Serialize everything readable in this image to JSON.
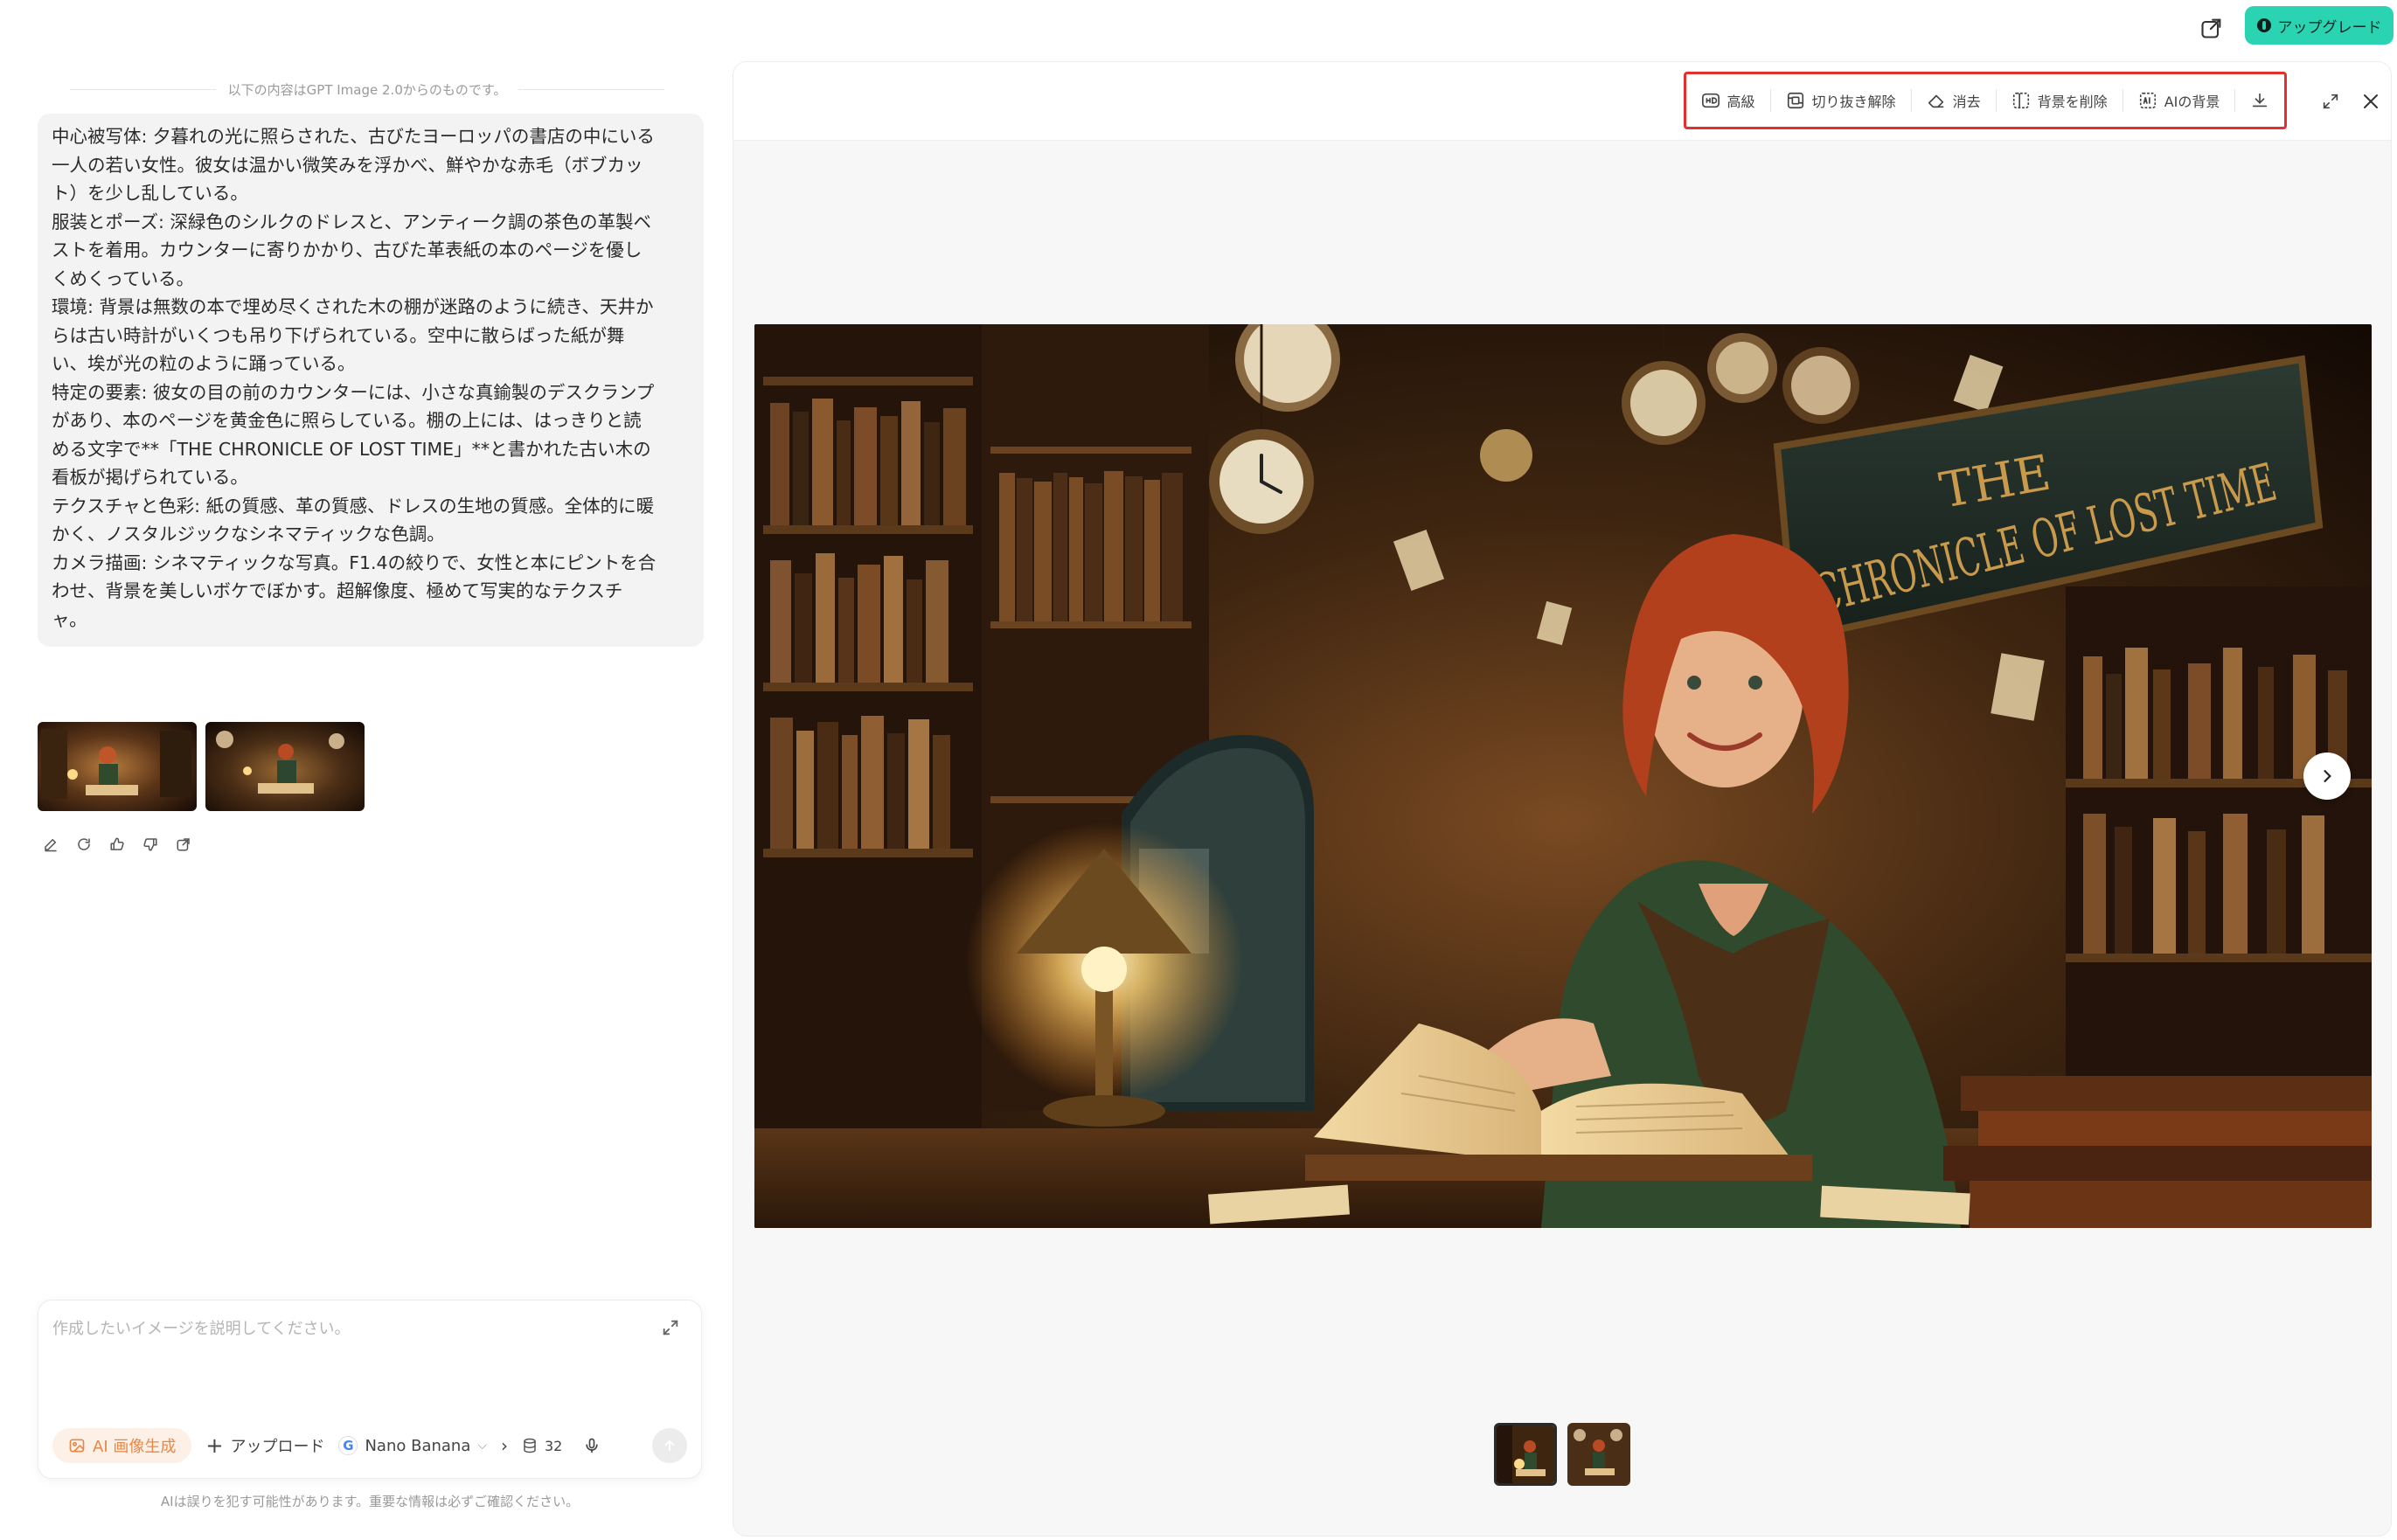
{
  "header": {
    "upgrade_label": "アップグレード",
    "accent_color": "#2ad4b2"
  },
  "chat": {
    "source_note": "以下の内容はGPT Image 2.0からのものです。",
    "prompt_lines": [
      "中心被写体: 夕暮れの光に照らされた、古びたヨーロッパの書店の中にいる",
      "一人の若い女性。彼女は温かい微笑みを浮かべ、鮮やかな赤毛（ボブカッ",
      "ト）を少し乱している。",
      "服装とポーズ: 深緑色のシルクのドレスと、アンティーク調の茶色の革製ベ",
      "ストを着用。カウンターに寄りかかり、古びた革表紙の本のページを優し",
      "くめくっている。",
      "環境: 背景は無数の本で埋め尽くされた木の棚が迷路のように続き、天井か",
      "らは古い時計がいくつも吊り下げられている。空中に散らばった紙が舞",
      "い、埃が光の粒のように踊っている。",
      "特定の要素: 彼女の目の前のカウンターには、小さな真鍮製のデスクランプ",
      "があり、本のページを黄金色に照らしている。棚の上には、はっきりと読",
      "める文字で**「THE CHRONICLE OF LOST TIME」**と書かれた古い木の",
      "看板が掲げられている。",
      "テクスチャと色彩: 紙の質感、革の質感、ドレスの生地の質感。全体的に暖",
      "かく、ノスタルジックなシネマティックな色調。",
      "カメラ描画: シネマティックな写真。F1.4の絞りで、女性と本にピントを合",
      "わせ、背景を美しいボケでぼかす。超解像度、極めて写実的なテクスチ",
      "ャ。"
    ],
    "action_icons": [
      "edit-icon",
      "regenerate-icon",
      "thumbs-up-icon",
      "thumbs-down-icon",
      "share-icon"
    ]
  },
  "composer": {
    "placeholder": "作成したいイメージを説明してください。",
    "ai_gen_label": "AI 画像生成",
    "upload_label": "アップロード",
    "model_label": "Nano Banana",
    "credits": "32",
    "disclaimer": "AIは誤りを犯す可能性があります。重要な情報は必ずご確認ください。",
    "ai_gen_color": "#e6884a"
  },
  "preview": {
    "tools": [
      {
        "label": "高級",
        "icon": "hd-icon"
      },
      {
        "label": "切り抜き解除",
        "icon": "uncrop-icon"
      },
      {
        "label": "消去",
        "icon": "eraser-icon"
      },
      {
        "label": "背景を削除",
        "icon": "remove-background-icon"
      },
      {
        "label": "AIの背景",
        "icon": "ai-background-icon"
      }
    ],
    "highlight_color": "#e3302f",
    "image_sign_line1": "THE",
    "image_sign_line2": "CHRONICLE OF LOST TIME",
    "thumbnail_count": 2,
    "active_thumbnail": 1
  }
}
